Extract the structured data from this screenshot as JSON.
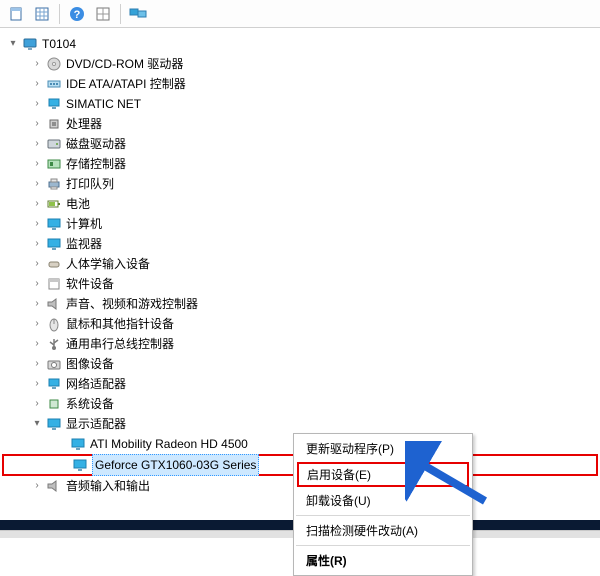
{
  "root": {
    "label": "T0104"
  },
  "categories": [
    {
      "label": "DVD/CD-ROM 驱动器",
      "icon": "disc-icon"
    },
    {
      "label": "IDE ATA/ATAPI 控制器",
      "icon": "controller-icon"
    },
    {
      "label": "SIMATIC NET",
      "icon": "network-icon"
    },
    {
      "label": "处理器",
      "icon": "cpu-icon"
    },
    {
      "label": "磁盘驱动器",
      "icon": "disk-icon"
    },
    {
      "label": "存储控制器",
      "icon": "storage-icon"
    },
    {
      "label": "打印队列",
      "icon": "printer-icon"
    },
    {
      "label": "电池",
      "icon": "battery-icon"
    },
    {
      "label": "计算机",
      "icon": "monitor-icon"
    },
    {
      "label": "监视器",
      "icon": "monitor-icon"
    },
    {
      "label": "人体学输入设备",
      "icon": "hid-icon"
    },
    {
      "label": "软件设备",
      "icon": "software-icon"
    },
    {
      "label": "声音、视频和游戏控制器",
      "icon": "audio-icon"
    },
    {
      "label": "鼠标和其他指针设备",
      "icon": "mouse-icon"
    },
    {
      "label": "通用串行总线控制器",
      "icon": "usb-icon"
    },
    {
      "label": "图像设备",
      "icon": "camera-icon"
    },
    {
      "label": "网络适配器",
      "icon": "network-icon"
    },
    {
      "label": "系统设备",
      "icon": "chip-icon"
    }
  ],
  "display_adapter": {
    "label": "显示适配器",
    "children": [
      {
        "label": "ATI Mobility Radeon HD 4500",
        "icon": "monitor-icon"
      },
      {
        "label": "Geforce GTX1060-03G Series",
        "icon": "monitor-icon",
        "highlight": true,
        "selected": true
      }
    ]
  },
  "audio_io": {
    "label": "音频输入和输出"
  },
  "context_menu": {
    "items": [
      {
        "label": "更新驱动程序(P)"
      },
      {
        "label": "启用设备(E)",
        "highlight": true
      },
      {
        "label": "卸载设备(U)"
      }
    ],
    "scan": "扫描检测硬件改动(A)",
    "props": "属性(R)"
  }
}
